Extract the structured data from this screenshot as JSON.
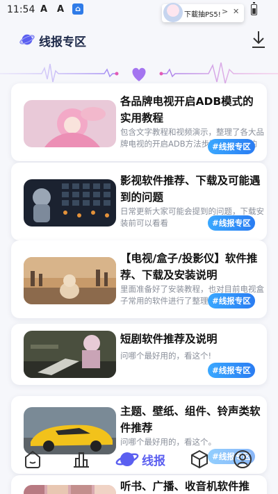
{
  "status_bar": {
    "time": "11:54",
    "icons": [
      "ad-icon",
      "ad-icon",
      "app-icon",
      "battery-icon"
    ],
    "notification": {
      "text": "下載抽PS5!",
      "arrow": ">",
      "close": "✕"
    }
  },
  "header": {
    "title": "线报专区",
    "logo_icon": "planet-icon",
    "action_icon": "download-icon"
  },
  "colors": {
    "accent": "#5b5ff0",
    "tag": "#2a8af2",
    "title": "#1e2a4a"
  },
  "cards": [
    {
      "title": "各品牌电视开启ADB模式的实用教程",
      "desc": "包含文字教程和视频演示，整理了各大品牌电视的开启ADB方法步骤，有需要的可以看看",
      "tag": "#线报专区"
    },
    {
      "title": "影视软件推荐、下载及可能遇到的问题",
      "desc": "日常更新大家可能会提到的问题，下载安装前可以看看",
      "tag": "#线报专区"
    },
    {
      "title": "【电视/盒子/投影仪】软件推荐、下载及安装说明",
      "desc": "里面准备好了安装教程，也对目前电视盒子常用的软件进行了整理说明",
      "tag": "#线报专区"
    },
    {
      "title": "短剧软件推荐及说明",
      "desc": "问哪个最好用的，看这个!",
      "tag": "#线报专区"
    },
    {
      "title": "主题、壁纸、组件、铃声类软件推荐",
      "desc": "问哪个最好用的，看这个。",
      "tag": "#线报专区"
    },
    {
      "title": "听书、广播、收音机软件推",
      "desc": "",
      "tag": ""
    }
  ],
  "bottom_nav": {
    "items": [
      {
        "icon": "home-face-icon",
        "label": ""
      },
      {
        "icon": "rank-bars-icon",
        "label": ""
      },
      {
        "icon": "planet-icon",
        "label": "线报"
      },
      {
        "icon": "cube-icon",
        "label": ""
      },
      {
        "icon": "profile-icon",
        "label": ""
      }
    ]
  }
}
